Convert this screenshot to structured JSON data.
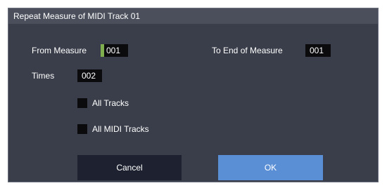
{
  "dialog": {
    "title": "Repeat Measure of MIDI Track 01",
    "from_measure": {
      "label": "From Measure",
      "value": "001"
    },
    "to_end_of_measure": {
      "label": "To End of Measure",
      "value": "001"
    },
    "times": {
      "label": "Times",
      "value": "002"
    },
    "all_tracks": {
      "label": "All Tracks",
      "checked": false
    },
    "all_midi_tracks": {
      "label": "All MIDI Tracks",
      "checked": false
    },
    "cancel_label": "Cancel",
    "ok_label": "OK"
  },
  "colors": {
    "background": "#3a3e4a",
    "titlebar": "#4a4f5b",
    "field": "#0b0b0e",
    "focus_accent": "#7fae4f",
    "ok_button": "#5a8fd6",
    "cancel_button": "#1e2230"
  }
}
